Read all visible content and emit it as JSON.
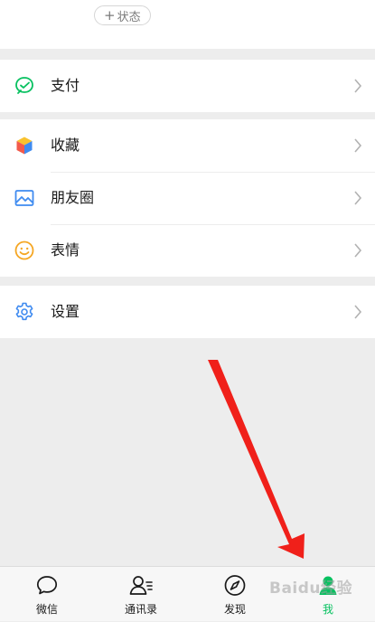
{
  "status": {
    "plus_glyph": "+",
    "label": "状态"
  },
  "menu": {
    "pay": {
      "label": "支付",
      "icon": "pay-icon"
    },
    "favorites": {
      "label": "收藏",
      "icon": "favorites-cube-icon"
    },
    "moments": {
      "label": "朋友圈",
      "icon": "moments-image-icon"
    },
    "stickers": {
      "label": "表情",
      "icon": "smiley-icon"
    },
    "settings": {
      "label": "设置",
      "icon": "gear-icon"
    }
  },
  "tabbar": {
    "tabs": [
      {
        "label": "微信",
        "icon": "chat-bubble-icon",
        "active": false
      },
      {
        "label": "通讯录",
        "icon": "contacts-icon",
        "active": false
      },
      {
        "label": "发现",
        "icon": "compass-icon",
        "active": false
      },
      {
        "label": "我",
        "icon": "me-person-icon",
        "active": true
      }
    ]
  },
  "watermark": {
    "text": "Baidu经验"
  },
  "colors": {
    "accent": "#07c160",
    "background": "#ededed",
    "arrow": "#f0201a"
  }
}
